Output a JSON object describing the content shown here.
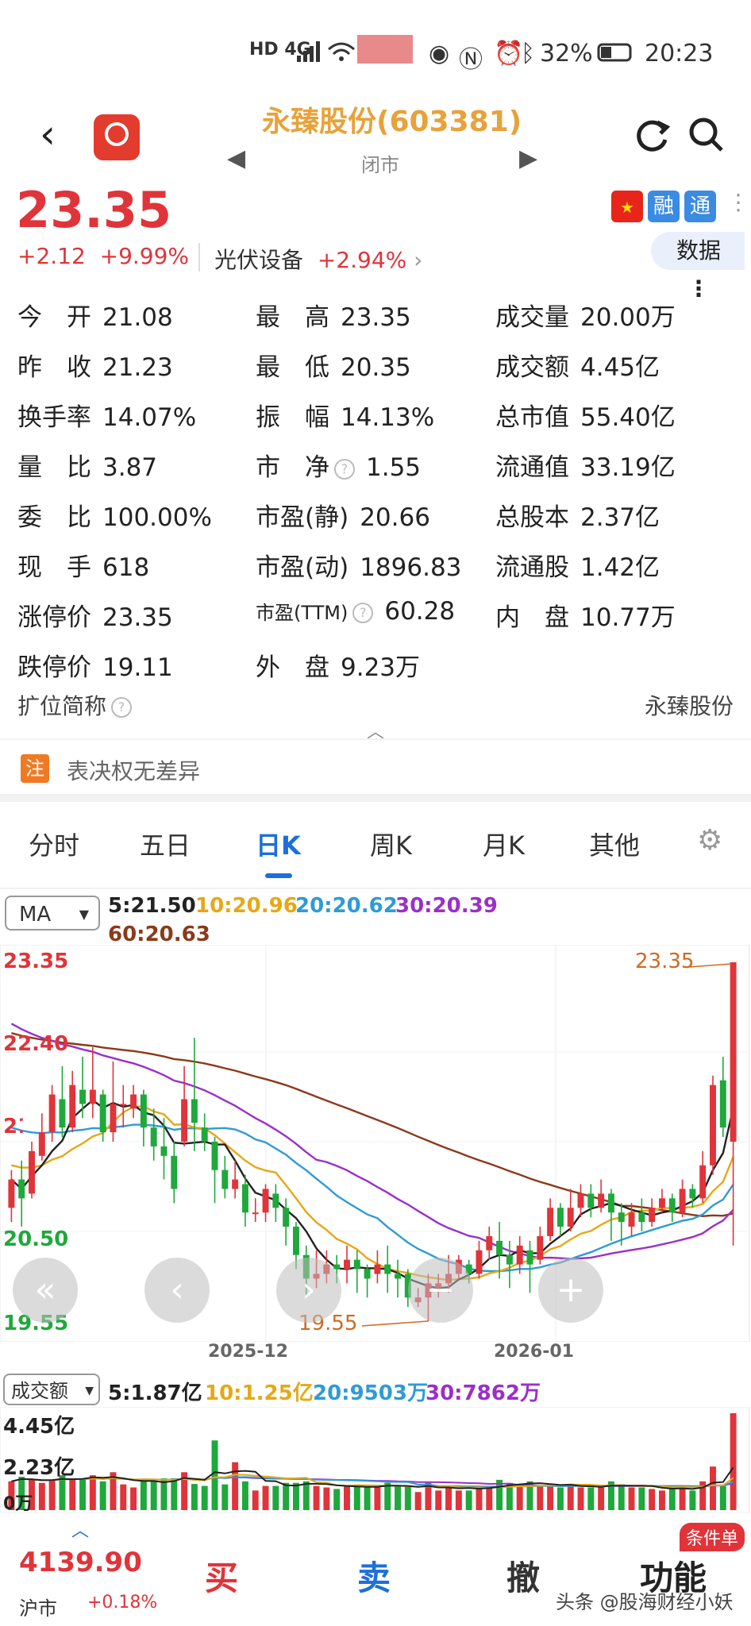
{
  "status_bar": {
    "network": "HD 4G",
    "battery": "32%",
    "time": "20:23"
  },
  "header": {
    "title": "永臻股份(603381)",
    "market_status": "闭市"
  },
  "quote": {
    "price": "23.35",
    "change": "+2.12",
    "change_pct": "+9.99%",
    "sector_name": "光伏设备",
    "sector_pct": "+2.94%",
    "data_button": "数据"
  },
  "badges": [
    {
      "label": "融",
      "color": "#3b8be3"
    },
    {
      "label": "通",
      "color": "#3b8be3"
    }
  ],
  "metrics": [
    [
      {
        "label": "今　开",
        "value": "21.08"
      },
      {
        "label": "最　高",
        "value": "23.35"
      },
      {
        "label": "成交量",
        "value": "20.00万"
      }
    ],
    [
      {
        "label": "昨　收",
        "value": "21.23"
      },
      {
        "label": "最　低",
        "value": "20.35"
      },
      {
        "label": "成交额",
        "value": "4.45亿"
      }
    ],
    [
      {
        "label": "换手率",
        "value": "14.07%"
      },
      {
        "label": "振　幅",
        "value": "14.13%"
      },
      {
        "label": "总市值",
        "value": "55.40亿"
      }
    ],
    [
      {
        "label": "量　比",
        "value": "3.87"
      },
      {
        "label": "市　净",
        "value": "1.55"
      },
      {
        "label": "流通值",
        "value": "33.19亿"
      }
    ],
    [
      {
        "label": "委　比",
        "value": "100.00%"
      },
      {
        "label": "市盈(静)",
        "value": "20.66"
      },
      {
        "label": "总股本",
        "value": "2.37亿"
      }
    ],
    [
      {
        "label": "现　手",
        "value": "618"
      },
      {
        "label": "市盈(动)",
        "value": "1896.83"
      },
      {
        "label": "流通股",
        "value": "1.42亿"
      }
    ],
    [
      {
        "label": "涨停价",
        "value": "23.35"
      },
      {
        "label": "市盈(TTM)",
        "value": "60.28"
      },
      {
        "label": "内　盘",
        "value": "10.77万"
      }
    ],
    [
      {
        "label": "跌停价",
        "value": "19.11"
      },
      {
        "label": "外　盘",
        "value": "9.23万"
      }
    ]
  ],
  "short_name": {
    "label": "扩位简称",
    "value": "永臻股份"
  },
  "notice": {
    "tag": "注",
    "text": "表决权无差异"
  },
  "tabs": [
    "分时",
    "五日",
    "日K",
    "周K",
    "月K",
    "其他"
  ],
  "ma_legend": {
    "select": "MA",
    "items": [
      {
        "text": "5:21.50",
        "color": "#222222"
      },
      {
        "text": "10:20.96",
        "color": "#e6a817"
      },
      {
        "text": "20:20.62",
        "color": "#2e9bd6"
      },
      {
        "text": "30:20.39",
        "color": "#9b2fc9"
      },
      {
        "text": "60:20.63",
        "color": "#8b3a1a"
      }
    ]
  },
  "chart_data": {
    "type": "candlestick",
    "y_ticks": [
      "23.35",
      "22.40",
      "21.45",
      "20.50",
      "19.55"
    ],
    "ylim": [
      19.55,
      23.35
    ],
    "x_labels": [
      "2025-12",
      "2026-01"
    ],
    "max_marker": "23.35",
    "min_marker": "19.55",
    "candles": [
      {
        "o": 20.75,
        "c": 21.05,
        "h": 21.15,
        "l": 20.6
      },
      {
        "o": 21.05,
        "c": 20.85,
        "h": 21.25,
        "l": 20.55
      },
      {
        "o": 20.9,
        "c": 21.35,
        "h": 21.45,
        "l": 20.85
      },
      {
        "o": 21.3,
        "c": 21.55,
        "h": 21.75,
        "l": 21.25
      },
      {
        "o": 21.55,
        "c": 21.95,
        "h": 22.05,
        "l": 21.45
      },
      {
        "o": 21.9,
        "c": 21.6,
        "h": 22.25,
        "l": 21.5
      },
      {
        "o": 21.6,
        "c": 22.05,
        "h": 22.2,
        "l": 21.55
      },
      {
        "o": 22.0,
        "c": 21.85,
        "h": 22.35,
        "l": 21.7
      },
      {
        "o": 21.85,
        "c": 22.0,
        "h": 22.45,
        "l": 21.7
      },
      {
        "o": 21.95,
        "c": 21.55,
        "h": 22.0,
        "l": 21.45
      },
      {
        "o": 21.55,
        "c": 21.85,
        "h": 22.3,
        "l": 21.45
      },
      {
        "o": 21.85,
        "c": 21.85,
        "h": 22.05,
        "l": 21.6
      },
      {
        "o": 21.8,
        "c": 21.95,
        "h": 22.05,
        "l": 21.7
      },
      {
        "o": 21.95,
        "c": 21.6,
        "h": 22.0,
        "l": 21.4
      },
      {
        "o": 21.6,
        "c": 21.4,
        "h": 21.8,
        "l": 21.25
      },
      {
        "o": 21.4,
        "c": 21.3,
        "h": 21.7,
        "l": 21.05
      },
      {
        "o": 21.3,
        "c": 20.95,
        "h": 21.45,
        "l": 20.8
      },
      {
        "o": 21.45,
        "c": 21.9,
        "h": 22.25,
        "l": 21.4
      },
      {
        "o": 21.9,
        "c": 21.65,
        "h": 22.55,
        "l": 21.35
      },
      {
        "o": 21.6,
        "c": 21.45,
        "h": 21.75,
        "l": 21.35
      },
      {
        "o": 21.45,
        "c": 21.15,
        "h": 21.5,
        "l": 20.8
      },
      {
        "o": 21.15,
        "c": 20.95,
        "h": 21.3,
        "l": 20.85
      },
      {
        "o": 20.95,
        "c": 21.05,
        "h": 21.25,
        "l": 20.85
      },
      {
        "o": 21.0,
        "c": 20.7,
        "h": 21.1,
        "l": 20.55
      },
      {
        "o": 20.7,
        "c": 20.7,
        "h": 20.85,
        "l": 20.6
      },
      {
        "o": 20.7,
        "c": 20.95,
        "h": 21.0,
        "l": 20.6
      },
      {
        "o": 20.9,
        "c": 20.75,
        "h": 21.0,
        "l": 20.6
      },
      {
        "o": 20.75,
        "c": 20.55,
        "h": 20.85,
        "l": 20.35
      },
      {
        "o": 20.55,
        "c": 20.25,
        "h": 20.6,
        "l": 20.1
      },
      {
        "o": 20.25,
        "c": 20.0,
        "h": 20.35,
        "l": 19.8
      },
      {
        "o": 20.0,
        "c": 20.05,
        "h": 20.3,
        "l": 19.9
      },
      {
        "o": 20.05,
        "c": 20.15,
        "h": 20.3,
        "l": 19.95
      },
      {
        "o": 20.15,
        "c": 20.1,
        "h": 20.25,
        "l": 19.95
      },
      {
        "o": 20.1,
        "c": 20.2,
        "h": 20.35,
        "l": 19.95
      },
      {
        "o": 20.2,
        "c": 20.1,
        "h": 20.3,
        "l": 19.85
      },
      {
        "o": 20.1,
        "c": 20.0,
        "h": 20.15,
        "l": 19.8
      },
      {
        "o": 20.05,
        "c": 20.15,
        "h": 20.3,
        "l": 19.95
      },
      {
        "o": 20.15,
        "c": 20.05,
        "h": 20.35,
        "l": 19.85
      },
      {
        "o": 20.05,
        "c": 20.0,
        "h": 20.2,
        "l": 19.8
      },
      {
        "o": 20.05,
        "c": 19.8,
        "h": 20.1,
        "l": 19.7
      },
      {
        "o": 19.75,
        "c": 19.8,
        "h": 19.9,
        "l": 19.7
      },
      {
        "o": 19.8,
        "c": 19.95,
        "h": 20.05,
        "l": 19.55
      },
      {
        "o": 19.9,
        "c": 19.95,
        "h": 20.05,
        "l": 19.8
      },
      {
        "o": 19.95,
        "c": 20.05,
        "h": 20.25,
        "l": 19.85
      },
      {
        "o": 20.05,
        "c": 20.2,
        "h": 20.25,
        "l": 20.0
      },
      {
        "o": 20.15,
        "c": 20.05,
        "h": 20.2,
        "l": 19.95
      },
      {
        "o": 20.05,
        "c": 20.3,
        "h": 20.4,
        "l": 20.0
      },
      {
        "o": 20.3,
        "c": 20.45,
        "h": 20.55,
        "l": 20.2
      },
      {
        "o": 20.4,
        "c": 20.25,
        "h": 20.6,
        "l": 20.0
      },
      {
        "o": 20.25,
        "c": 20.15,
        "h": 20.4,
        "l": 19.9
      },
      {
        "o": 20.15,
        "c": 20.35,
        "h": 20.45,
        "l": 20.05
      },
      {
        "o": 20.3,
        "c": 20.15,
        "h": 20.4,
        "l": 19.85
      },
      {
        "o": 20.2,
        "c": 20.45,
        "h": 20.55,
        "l": 20.15
      },
      {
        "o": 20.45,
        "c": 20.75,
        "h": 20.85,
        "l": 20.4
      },
      {
        "o": 20.75,
        "c": 20.55,
        "h": 20.8,
        "l": 20.45
      },
      {
        "o": 20.55,
        "c": 20.75,
        "h": 20.95,
        "l": 20.5
      },
      {
        "o": 20.75,
        "c": 20.9,
        "h": 21.0,
        "l": 20.65
      },
      {
        "o": 20.9,
        "c": 20.75,
        "h": 21.0,
        "l": 20.65
      },
      {
        "o": 20.75,
        "c": 20.9,
        "h": 21.05,
        "l": 20.7
      },
      {
        "o": 20.9,
        "c": 20.7,
        "h": 20.95,
        "l": 20.4
      },
      {
        "o": 20.7,
        "c": 20.6,
        "h": 20.8,
        "l": 20.35
      },
      {
        "o": 20.55,
        "c": 20.7,
        "h": 20.8,
        "l": 20.45
      },
      {
        "o": 20.7,
        "c": 20.6,
        "h": 20.85,
        "l": 20.5
      },
      {
        "o": 20.6,
        "c": 20.75,
        "h": 20.85,
        "l": 20.55
      },
      {
        "o": 20.75,
        "c": 20.85,
        "h": 20.95,
        "l": 20.7
      },
      {
        "o": 20.85,
        "c": 20.7,
        "h": 20.9,
        "l": 20.6
      },
      {
        "o": 20.7,
        "c": 20.95,
        "h": 21.05,
        "l": 20.65
      },
      {
        "o": 20.95,
        "c": 20.85,
        "h": 21.0,
        "l": 20.75
      },
      {
        "o": 20.85,
        "c": 21.2,
        "h": 21.35,
        "l": 20.8
      },
      {
        "o": 21.2,
        "c": 22.05,
        "h": 22.15,
        "l": 21.1
      },
      {
        "o": 22.1,
        "c": 21.6,
        "h": 22.35,
        "l": 21.5
      },
      {
        "o": 21.45,
        "c": 23.35,
        "h": 23.35,
        "l": 20.35
      }
    ]
  },
  "volume_panel": {
    "select": "成交额",
    "legend": [
      {
        "text": "5:1.87亿",
        "color": "#222222"
      },
      {
        "text": "10:1.25亿",
        "color": "#e6a817"
      },
      {
        "text": "20:9503万",
        "color": "#2e9bd6"
      },
      {
        "text": "30:7862万",
        "color": "#9b2fc9"
      }
    ],
    "y_ticks": [
      "4.45亿",
      "2.23亿",
      "0万"
    ],
    "max": 4.45
  },
  "bottom_bar": {
    "index_value": "4139.90",
    "index_name": "沪市",
    "index_pct": "+0.18%",
    "buy": "买",
    "sell": "卖",
    "cancel": "撤",
    "func": "功能",
    "func_tag": "条件单",
    "watermark": "头条 @股海财经小妖"
  },
  "colors": {
    "up": "#e0343a",
    "down": "#1fa83c",
    "accent": "#1e6fd9"
  }
}
